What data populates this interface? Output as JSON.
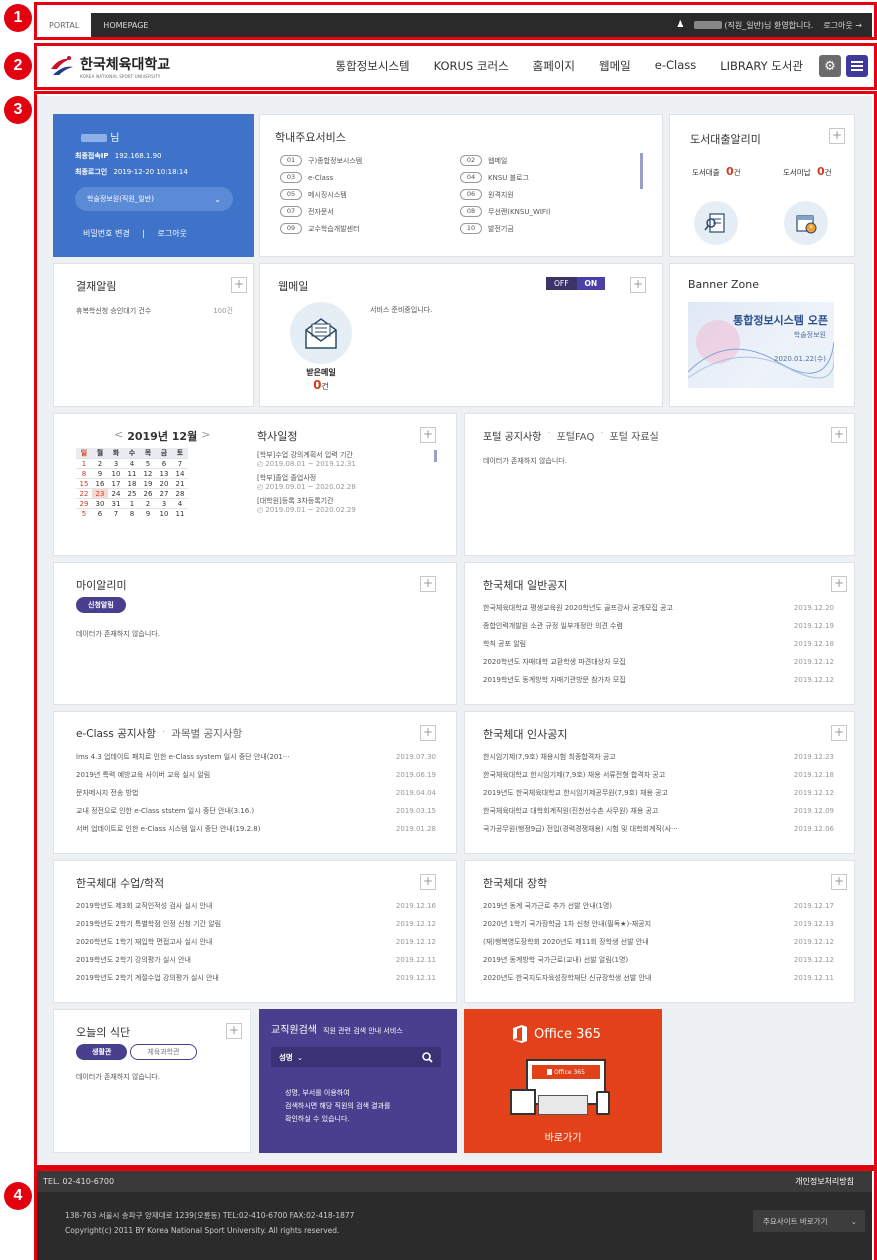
{
  "top": {
    "tab_portal": "PORTAL",
    "tab_homepage": "HOMEPAGE",
    "welcome": "(직원_일반)님 환영합니다.",
    "logout": "로그아웃 →"
  },
  "nav": {
    "logo_kr": "한국체육대학교",
    "logo_en": "KOREA NATIONAL SPORT UNIVERSITY",
    "items": [
      "통합정보시스템",
      "KORUS 코러스",
      "홈페이지",
      "웹메일",
      "e-Class",
      "LIBRARY 도서관"
    ]
  },
  "badges": [
    "1",
    "2",
    "3",
    "4"
  ],
  "profile": {
    "suffix": "님",
    "ip_label": "최종접속IP",
    "ip": "192.168.1.90",
    "login_label": "최종로그인",
    "login": "2019-12-20 10:18:14",
    "role": "학술정보원(직원_일반)",
    "pw_change": "비밀번호 변경",
    "sep": "|",
    "logout": "로그아웃"
  },
  "services": {
    "title": "학내주요서비스",
    "items": [
      {
        "n": "01",
        "t": "구)종합정보시스템"
      },
      {
        "n": "02",
        "t": "웹메일"
      },
      {
        "n": "03",
        "t": "e-Class"
      },
      {
        "n": "04",
        "t": "KNSU 블로그"
      },
      {
        "n": "05",
        "t": "메시징시스템"
      },
      {
        "n": "06",
        "t": "원격지원"
      },
      {
        "n": "07",
        "t": "전자문서"
      },
      {
        "n": "08",
        "t": "무선랜(KNSU_WIFI)"
      },
      {
        "n": "09",
        "t": "교수학습개발센터"
      },
      {
        "n": "10",
        "t": "발전기금"
      }
    ]
  },
  "library": {
    "title": "도서대출알리미",
    "loan_label": "도서대출",
    "loan_count": "0",
    "loan_unit": "건",
    "overdue_label": "도서미납",
    "overdue_count": "0",
    "overdue_unit": "건"
  },
  "approval": {
    "title": "결재알림",
    "item": "휴복학신청 승인대기 건수",
    "count": "100건"
  },
  "webmail": {
    "title": "웹메일",
    "off": "OFF",
    "on": "ON",
    "notice": "서비스 준비중입니다.",
    "recv": "받은메일",
    "recv_count": "0",
    "recv_unit": "건"
  },
  "banner": {
    "title": "Banner Zone",
    "headline": "통합정보시스템 오픈",
    "sub": "학술정보원",
    "date": "2020.01.22(수)"
  },
  "calendar": {
    "prev": "<",
    "month": "2019년 12월",
    "next": ">",
    "days": [
      "일",
      "월",
      "화",
      "수",
      "목",
      "금",
      "토"
    ],
    "weeks": [
      [
        "1",
        "2",
        "3",
        "4",
        "5",
        "6",
        "7"
      ],
      [
        "8",
        "9",
        "10",
        "11",
        "12",
        "13",
        "14"
      ],
      [
        "15",
        "16",
        "17",
        "18",
        "19",
        "20",
        "21"
      ],
      [
        "22",
        "23",
        "24",
        "25",
        "26",
        "27",
        "28"
      ],
      [
        "29",
        "30",
        "31",
        "1",
        "2",
        "3",
        "4"
      ],
      [
        "5",
        "6",
        "7",
        "8",
        "9",
        "10",
        "11"
      ]
    ]
  },
  "schedule": {
    "title": "학사일정",
    "items": [
      {
        "t": "[학부]수업 강의계획서 입력 기간",
        "d": "2019.08.01 ~ 2019.12.31"
      },
      {
        "t": "[학부]졸업 졸업사정",
        "d": "2019.09.01 ~ 2020.02.28"
      },
      {
        "t": "[대학원]등록 3차등록기간",
        "d": "2019.09.01 ~ 2020.02.29"
      }
    ]
  },
  "portal": {
    "tab1": "포털 공지사항",
    "tab2": "포털FAQ",
    "tab3": "포털 자료실",
    "dot": "·",
    "nodata": "데이터가 존재하지 않습니다."
  },
  "myalarm": {
    "title": "마이알리미",
    "btn": "신청알림",
    "nodata": "데이터가 존재하지 않습니다."
  },
  "general": {
    "title": "한국체대 일반공지",
    "rows": [
      {
        "t": "한국체육대학교 평생교육원 2020학년도 골프강사 공개모집 공고",
        "d": "2019.12.20"
      },
      {
        "t": "종합인력개발원 소관 규정 일부개정안 의견 수렴",
        "d": "2019.12.19"
      },
      {
        "t": "학칙 공포 알림",
        "d": "2019.12.18"
      },
      {
        "t": "2020학년도 자매대학 교환학생 파견대상자 모집",
        "d": "2019.12.12"
      },
      {
        "t": "2019학년도 동계방학 자매기관방문 참가자 모집",
        "d": "2019.12.12"
      }
    ]
  },
  "eclass": {
    "tab1": "e-Class 공지사항",
    "dot": "·",
    "tab2": "과목별 공지사항",
    "rows": [
      {
        "t": "lms 4.3 업데이트 패치로 인한 e-Class system 일시 중단 안내(201···",
        "d": "2019.07.30"
      },
      {
        "t": "2019년 특력 예방교육 사이버 교육 실시 알림",
        "d": "2019.06.19"
      },
      {
        "t": "문자메시지 전송 방법",
        "d": "2019.04.04"
      },
      {
        "t": "교내 정전으로 인한 e-Class ststem 일시 중단 안내(3.16.)",
        "d": "2019.03.15"
      },
      {
        "t": "서버 업데이트로 인한 e-Class 시스템 일시 중단 안내(19.2.8)",
        "d": "2019.01.28"
      }
    ]
  },
  "hr": {
    "title": "한국체대 인사공지",
    "rows": [
      {
        "t": "한시임기제(7,9호) 채용시험 최종합격자 공고",
        "d": "2019.12.23"
      },
      {
        "t": "한국체육대학교 한시임기제(7,9호) 채용 서류전형 합격자 공고",
        "d": "2019.12.18"
      },
      {
        "t": "2019년도 한국체육대학교 한시임기제공무원(7,9호) 채용 공고",
        "d": "2019.12.12"
      },
      {
        "t": "한국체육대학교 대학회계직원(진천선수촌 사무원) 채용 공고",
        "d": "2019.12.09"
      },
      {
        "t": "국가공무원(행정9급) 전입(경력경쟁채용) 시험 및 대학회계직(사···",
        "d": "2019.12.06"
      }
    ]
  },
  "academic": {
    "title": "한국체대 수업/학적",
    "rows": [
      {
        "t": "2019학년도 제3회 교직인적성 검사 실시 안내",
        "d": "2019.12.16"
      },
      {
        "t": "2019학년도 2학기 특별학점 인정 신청 기간 알림",
        "d": "2019.12.12"
      },
      {
        "t": "2020학년도 1학기 재입학 면접고사 실시 안내",
        "d": "2019.12.12"
      },
      {
        "t": "2019학년도 2학기 강의평가 실시 안내",
        "d": "2019.12.11"
      },
      {
        "t": "2019학년도 2학기 계절수업 강의평가 실시 안내",
        "d": "2019.12.11"
      }
    ]
  },
  "scholar": {
    "title": "한국체대 장학",
    "rows": [
      {
        "t": "2019년 동계 국가근로 추가 선발 안내(1명)",
        "d": "2019.12.17"
      },
      {
        "t": "2020년 1학기 국가장학금 1차 신청 안내(필독★)-재공지",
        "d": "2019.12.13"
      },
      {
        "t": "(재)행복영도장학회 2020년도 제11회 장학생 선발 안내",
        "d": "2019.12.12"
      },
      {
        "t": "2019년 동계방학 국가근로(교내) 선발 알림(1명)",
        "d": "2019.12.12"
      },
      {
        "t": "2020년도 한국지도자육성장학재단 신규장학생 선발 안내",
        "d": "2019.12.11"
      }
    ]
  },
  "meal": {
    "title": "오늘의 식단",
    "tab1": "생활관",
    "tab2": "체육과학관",
    "nodata": "데이터가 존재하지 않습니다."
  },
  "staff": {
    "title": "교직원검색",
    "sub": "직원 관련 검색 안내 서비스",
    "select": "성명",
    "desc1": "성명, 부서를 이용하여",
    "desc2": "검색하시면 해당 직원의 검색 결과를",
    "desc3": "확인하실 수 있습니다."
  },
  "office": {
    "name": "Office 365",
    "inner": "Office 365",
    "go": "바로가기"
  },
  "footer": {
    "tel": "TEL. 02-410-6700",
    "privacy": "개인정보처리방침",
    "addr": "138-763 서울시 송파구 양재대로 1239(오륜동) TEL:02-410-6700 FAX:02-418-1877",
    "copy": "Copyright(c) 2011 BY Korea National Sport University. All rights reserved.",
    "sites": "주요사이트 바로가기"
  },
  "colors": {
    "red": "#e3000f",
    "blue": "#3e73c9",
    "purple": "#483f8e",
    "orange": "#e2411a",
    "date_red": "#d63a1f"
  }
}
